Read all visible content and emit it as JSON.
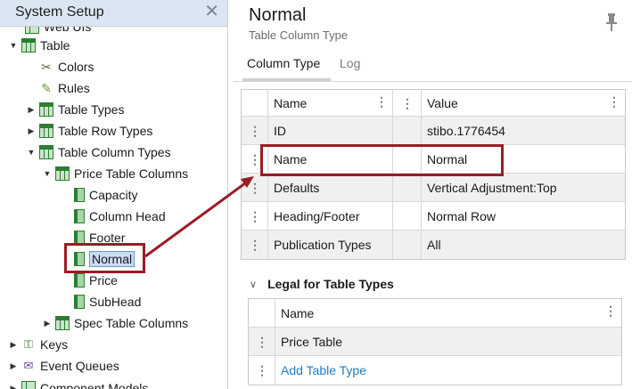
{
  "left_panel": {
    "title": "System Setup",
    "close_glyph": "✕",
    "tree": [
      {
        "label": "Web UIs",
        "icon": "web-ui-icon"
      },
      {
        "label": "Table",
        "icon": "table-icon"
      },
      {
        "label": "Colors",
        "icon": "colors-icon"
      },
      {
        "label": "Rules",
        "icon": "rules-icon"
      },
      {
        "label": "Table Types",
        "icon": "table-types-icon"
      },
      {
        "label": "Table Row Types",
        "icon": "table-row-types-icon"
      },
      {
        "label": "Table Column Types",
        "icon": "table-column-types-icon"
      },
      {
        "label": "Price Table Columns",
        "icon": "column-group-icon"
      },
      {
        "label": "Capacity",
        "icon": "column-icon"
      },
      {
        "label": "Column Head",
        "icon": "column-icon"
      },
      {
        "label": "Footer",
        "icon": "column-icon"
      },
      {
        "label": "Normal",
        "icon": "column-icon"
      },
      {
        "label": "Price",
        "icon": "column-icon"
      },
      {
        "label": "SubHead",
        "icon": "column-icon"
      },
      {
        "label": "Spec Table Columns",
        "icon": "column-group-icon"
      },
      {
        "label": "Keys",
        "icon": "keys-icon"
      },
      {
        "label": "Event Queues",
        "icon": "event-queues-icon"
      },
      {
        "label": "Component Models",
        "icon": "component-models-icon"
      }
    ]
  },
  "right_panel": {
    "title": "Normal",
    "subtitle": "Table Column Type",
    "tabs": [
      "Column Type",
      "Log"
    ],
    "grid": {
      "headers": [
        "Name",
        "Value"
      ],
      "rows": [
        {
          "name": "ID",
          "value": "stibo.1776454"
        },
        {
          "name": "Name",
          "value": "Normal"
        },
        {
          "name": "Defaults",
          "value": "Vertical Adjustment:Top"
        },
        {
          "name": "Heading/Footer",
          "value": "Normal Row"
        },
        {
          "name": "Publication Types",
          "value": "All"
        }
      ]
    },
    "legal": {
      "title": "Legal for Table Types",
      "header": "Name",
      "rows": [
        "Price Table"
      ],
      "add_link": "Add Table Type"
    }
  },
  "colors": {
    "highlight": "#9b1c24",
    "header_bg": "#dce6f2",
    "link": "#1f7bc1"
  }
}
